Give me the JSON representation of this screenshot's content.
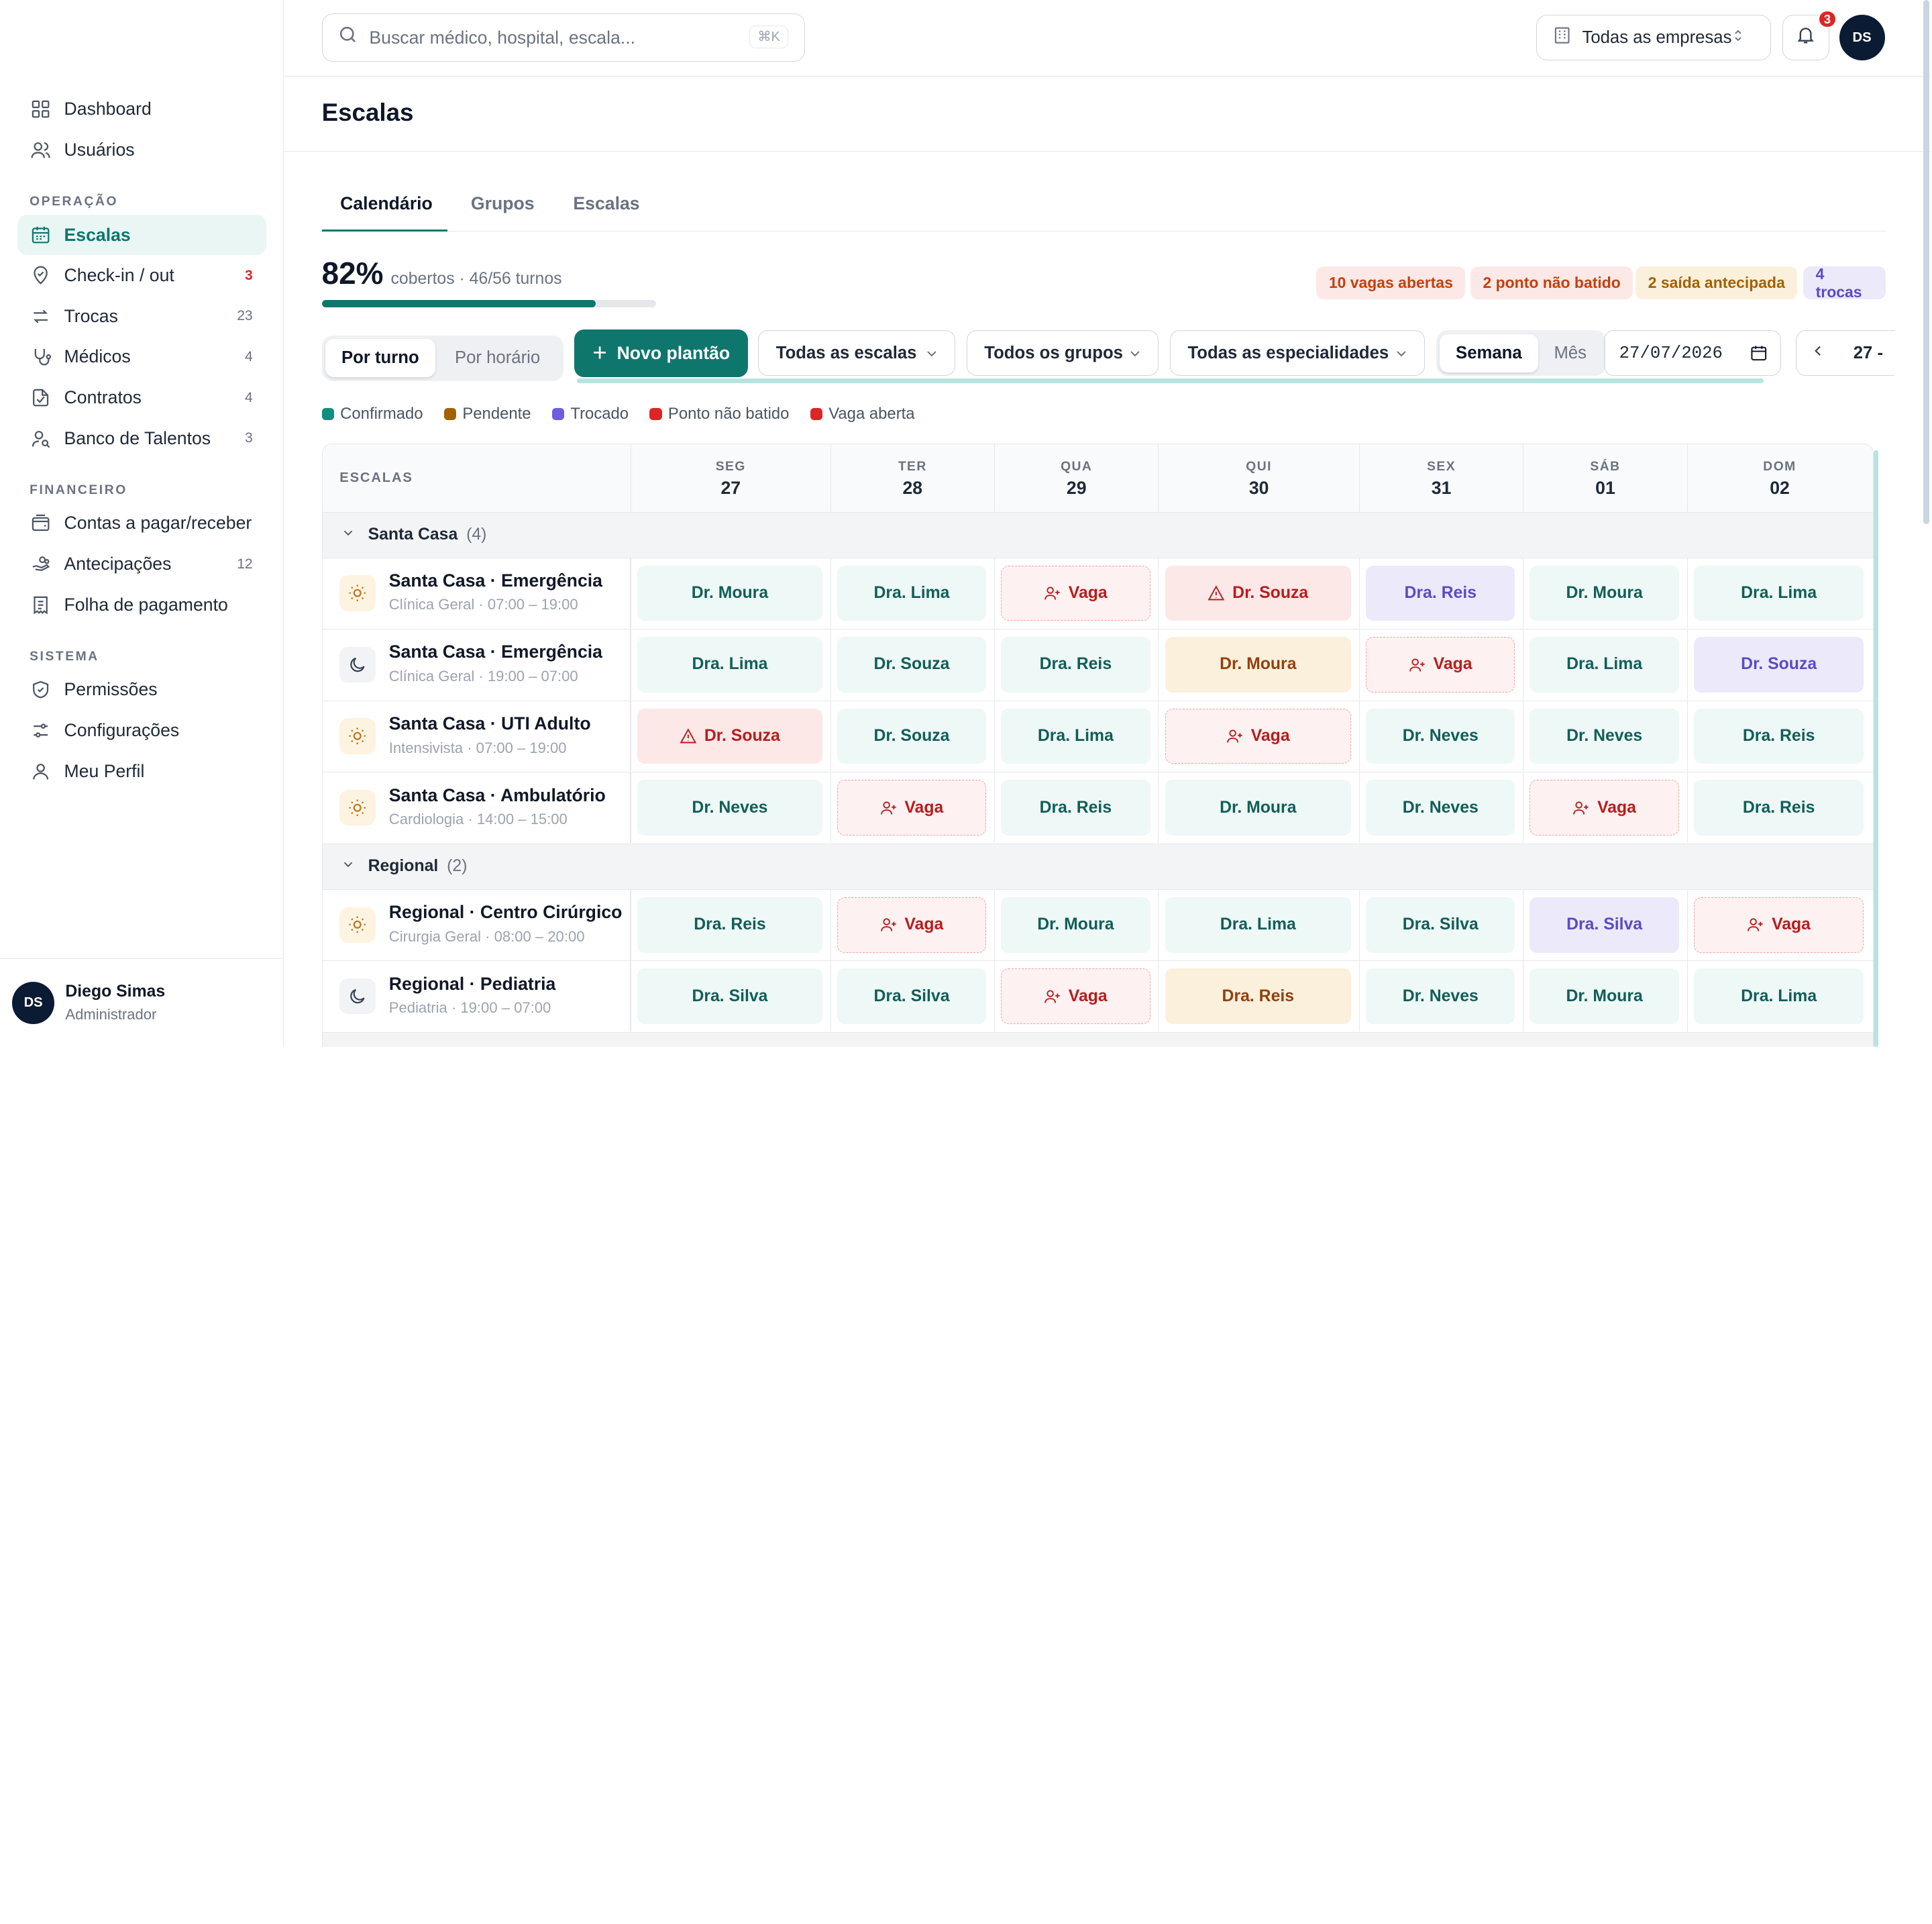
{
  "sidebar": {
    "nav_top": [
      {
        "label": "Dashboard",
        "icon": "dashboard-icon"
      },
      {
        "label": "Usuários",
        "icon": "users-icon"
      }
    ],
    "sections": [
      {
        "title": "OPERAÇÃO",
        "items": [
          {
            "label": "Escalas",
            "count": "",
            "active": true
          },
          {
            "label": "Check-in / out",
            "count": "3"
          },
          {
            "label": "Trocas",
            "count": "23"
          },
          {
            "label": "Médicos",
            "count": "4"
          },
          {
            "label": "Contratos",
            "count": "4"
          },
          {
            "label": "Banco de Talentos",
            "count": "3"
          }
        ]
      },
      {
        "title": "FINANCEIRO",
        "items": [
          {
            "label": "Contas a pagar/receber",
            "count": ""
          },
          {
            "label": "Antecipações",
            "count": "12"
          },
          {
            "label": "Folha de pagamento",
            "count": ""
          }
        ]
      },
      {
        "title": "SISTEMA",
        "items": [
          {
            "label": "Permissões"
          },
          {
            "label": "Configurações"
          },
          {
            "label": "Meu Perfil"
          }
        ]
      }
    ],
    "user": {
      "initials": "DS",
      "name": "Diego Simas",
      "role": "Administrador"
    }
  },
  "topbar": {
    "search_placeholder": "Buscar médico, hospital, escala...",
    "search_shortcut": "⌘K",
    "company": "Todas as empresas",
    "notifications": "3",
    "avatar": "DS"
  },
  "page": {
    "title": "Escalas",
    "tabs": [
      "Calendário",
      "Grupos",
      "Escalas"
    ],
    "coverage": {
      "pct": "82%",
      "sub": "cobertos · 46/56 turnos",
      "fraction": 0.82
    },
    "pills": [
      "10 vagas abertas",
      "2 ponto não batido",
      "2 saída antecipada",
      "4 trocas"
    ],
    "view_toggle": [
      "Por turno",
      "Por horário"
    ],
    "new_button": "Novo plantão",
    "filters": [
      "Todas as escalas",
      "Todos os grupos",
      "Todas as especialidades"
    ],
    "period_toggle": [
      "Semana",
      "Mês"
    ],
    "date": "27/07/2026",
    "week_label": "27 -",
    "legend": [
      "Confirmado",
      "Pendente",
      "Trocado",
      "Ponto não batido",
      "Vaga aberta"
    ]
  },
  "colors": {
    "accent": "#0f766e",
    "confirmado": "#0f8f7f",
    "pendente": "#a16207",
    "trocado": "#6d5ee0",
    "ponto_nao_batido": "#dc2626",
    "vaga_aberta": "#dc2626"
  },
  "grid": {
    "header_label": "ESCALAS",
    "days": [
      {
        "name": "SEG",
        "num": "27"
      },
      {
        "name": "TER",
        "num": "28"
      },
      {
        "name": "QUA",
        "num": "29"
      },
      {
        "name": "QUI",
        "num": "30"
      },
      {
        "name": "SEX",
        "num": "31"
      },
      {
        "name": "SÁB",
        "num": "01"
      },
      {
        "name": "DOM",
        "num": "02"
      }
    ],
    "groups": [
      {
        "name": "Santa Casa",
        "count": "(4)",
        "rows": [
          {
            "name": "Santa Casa · Emergência",
            "sub": "Clínica Geral · 07:00 – 19:00",
            "shift": "day",
            "cells": [
              [
                "Dr. Moura",
                "confirmed"
              ],
              [
                "Dra. Lima",
                "confirmed"
              ],
              [
                "Vaga",
                "open"
              ],
              [
                "Dr. Souza",
                "missed"
              ],
              [
                "Dra. Reis",
                "traded"
              ],
              [
                "Dr. Moura",
                "confirmed"
              ],
              [
                "Dra. Lima",
                "confirmed"
              ]
            ]
          },
          {
            "name": "Santa Casa · Emergência",
            "sub": "Clínica Geral · 19:00 – 07:00",
            "shift": "night",
            "cells": [
              [
                "Dra. Lima",
                "confirmed"
              ],
              [
                "Dr. Souza",
                "confirmed"
              ],
              [
                "Dra. Reis",
                "confirmed"
              ],
              [
                "Dr. Moura",
                "pending"
              ],
              [
                "Vaga",
                "open"
              ],
              [
                "Dra. Lima",
                "confirmed"
              ],
              [
                "Dr. Souza",
                "traded"
              ]
            ]
          },
          {
            "name": "Santa Casa · UTI Adulto",
            "sub": "Intensivista · 07:00 – 19:00",
            "shift": "day",
            "cells": [
              [
                "Dr. Souza",
                "missed"
              ],
              [
                "Dr. Souza",
                "confirmed"
              ],
              [
                "Dra. Lima",
                "confirmed"
              ],
              [
                "Vaga",
                "open"
              ],
              [
                "Dr. Neves",
                "confirmed"
              ],
              [
                "Dr. Neves",
                "confirmed"
              ],
              [
                "Dra. Reis",
                "confirmed"
              ]
            ]
          },
          {
            "name": "Santa Casa · Ambulatório",
            "sub": "Cardiologia · 14:00 – 15:00",
            "shift": "day",
            "cells": [
              [
                "Dr. Neves",
                "confirmed"
              ],
              [
                "Vaga",
                "open"
              ],
              [
                "Dra. Reis",
                "confirmed"
              ],
              [
                "Dr. Moura",
                "confirmed"
              ],
              [
                "Dr. Neves",
                "confirmed"
              ],
              [
                "Vaga",
                "open"
              ],
              [
                "Dra. Reis",
                "confirmed"
              ]
            ]
          }
        ]
      },
      {
        "name": "Regional",
        "count": "(2)",
        "rows": [
          {
            "name": "Regional · Centro Cirúrgico",
            "sub": "Cirurgia Geral · 08:00 – 20:00",
            "shift": "day",
            "cells": [
              [
                "Dra. Reis",
                "confirmed"
              ],
              [
                "Vaga",
                "open"
              ],
              [
                "Dr. Moura",
                "confirmed"
              ],
              [
                "Dra. Lima",
                "confirmed"
              ],
              [
                "Dra. Silva",
                "confirmed"
              ],
              [
                "Dra. Silva",
                "traded"
              ],
              [
                "Vaga",
                "open"
              ]
            ]
          },
          {
            "name": "Regional · Pediatria",
            "sub": "Pediatria · 19:00 – 07:00",
            "shift": "night",
            "cells": [
              [
                "Dra. Silva",
                "confirmed"
              ],
              [
                "Dra. Silva",
                "confirmed"
              ],
              [
                "Vaga",
                "open"
              ],
              [
                "Dra. Reis",
                "pending"
              ],
              [
                "Dr. Neves",
                "confirmed"
              ],
              [
                "Dr. Moura",
                "confirmed"
              ],
              [
                "Dra. Lima",
                "confirmed"
              ]
            ]
          }
        ]
      }
    ]
  }
}
